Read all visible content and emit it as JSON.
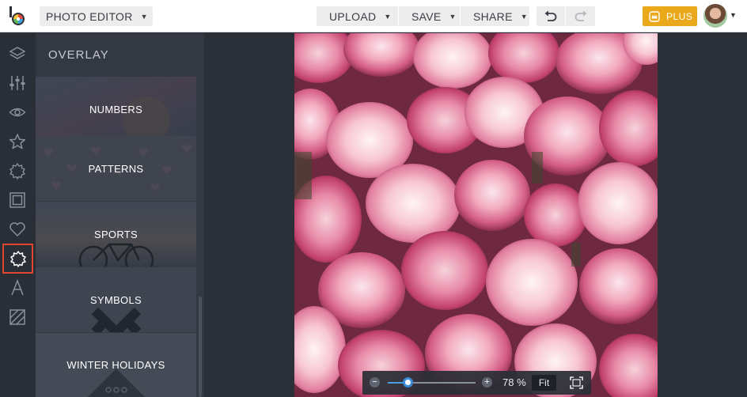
{
  "header": {
    "app_menu_label": "PHOTO EDITOR",
    "upload_label": "UPLOAD",
    "save_label": "SAVE",
    "share_label": "SHARE",
    "plus_label": "PLUS",
    "caret": "▼"
  },
  "tools": [
    {
      "name": "layers-icon"
    },
    {
      "name": "adjust-sliders-icon"
    },
    {
      "name": "eye-icon"
    },
    {
      "name": "star-icon"
    },
    {
      "name": "badge-icon"
    },
    {
      "name": "frame-icon"
    },
    {
      "name": "heart-icon"
    },
    {
      "name": "overlay-badge-icon",
      "active": true
    },
    {
      "name": "text-icon"
    },
    {
      "name": "texture-icon"
    }
  ],
  "panel": {
    "title": "OVERLAY",
    "categories": [
      "NUMBERS",
      "PATTERNS",
      "SPORTS",
      "SYMBOLS",
      "WINTER HOLIDAYS"
    ]
  },
  "zoom": {
    "minus": "−",
    "plus": "+",
    "percent_text": "78 %",
    "level": 0.23,
    "fit_label": "Fit"
  },
  "colors": {
    "accent": "#e9a91b",
    "active_tool_border": "#e0452f",
    "zoom_accent": "#3a8ad6"
  }
}
